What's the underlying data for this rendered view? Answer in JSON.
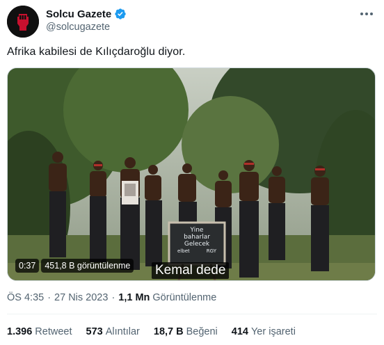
{
  "author": {
    "name": "Solcu Gazete",
    "handle": "@solcugazete"
  },
  "tweet": {
    "text": "Afrika kabilesi de Kılıçdaroğlu diyor."
  },
  "video": {
    "duration": "0:37",
    "views_overlay": "451,8 B görüntülenme",
    "subtitle": "Kemal dede",
    "sign_lines": [
      "Yine",
      "baharlar",
      "Gelecek",
      "elbet",
      "RGY"
    ]
  },
  "meta": {
    "time": "ÖS 4:35",
    "date": "27 Nis 2023",
    "views_count": "1,1 Mn",
    "views_label": "Görüntülenme"
  },
  "stats": {
    "retweets_count": "1.396",
    "retweets_label": "Retweet",
    "quotes_count": "573",
    "quotes_label": "Alıntılar",
    "likes_count": "18,7 B",
    "likes_label": "Beğeni",
    "bookmarks_count": "414",
    "bookmarks_label": "Yer işareti"
  },
  "colors": {
    "verified": "#1d9bf0",
    "secondary_text": "#536471",
    "avatar_bg": "#101010",
    "avatar_fist": "#c8102e"
  },
  "icons": {
    "avatar": "raised-fist-logo",
    "verified": "verified-badge-icon",
    "more": "more-options-icon"
  }
}
